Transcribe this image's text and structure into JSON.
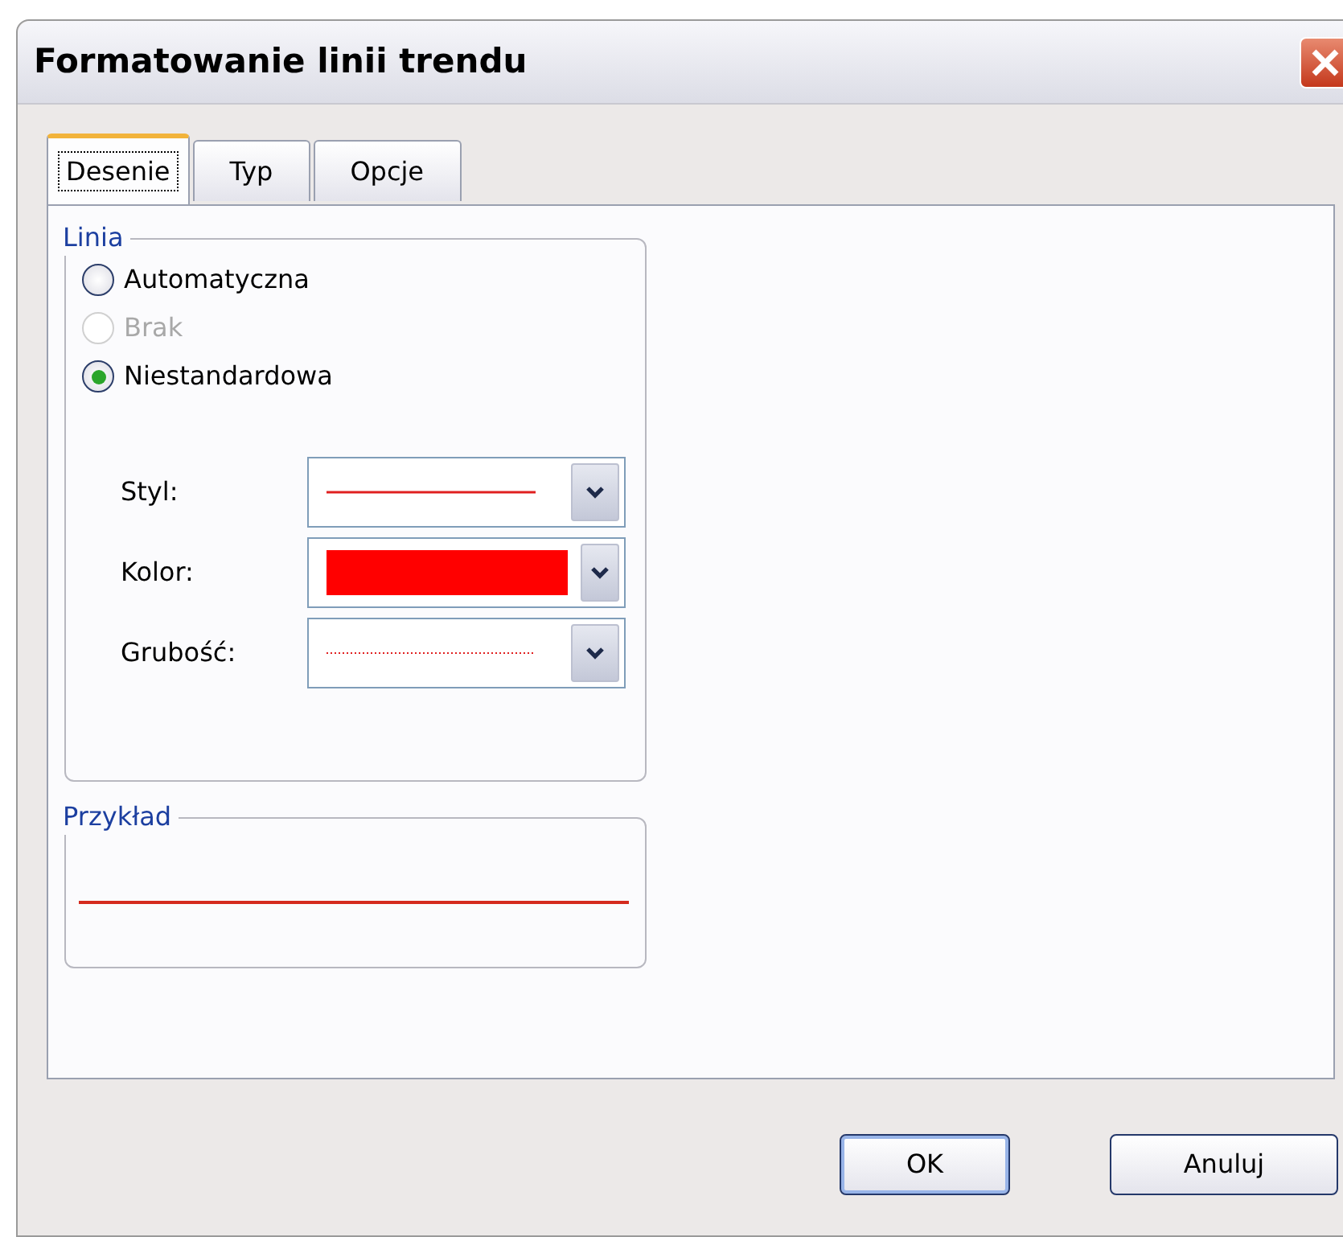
{
  "window": {
    "title": "Formatowanie linii trendu"
  },
  "tabs": [
    {
      "label": "Desenie",
      "selected": true
    },
    {
      "label": "Typ",
      "selected": false
    },
    {
      "label": "Opcje",
      "selected": false
    }
  ],
  "line_group": {
    "title": "Linia",
    "options": [
      {
        "label": "Automatyczna",
        "selected": false,
        "disabled": false
      },
      {
        "label": "Brak",
        "selected": false,
        "disabled": true
      },
      {
        "label": "Niestandardowa",
        "selected": true,
        "disabled": false
      }
    ],
    "fields": [
      {
        "label": "Styl:",
        "kind": "solid",
        "color": "#e02020"
      },
      {
        "label": "Kolor:",
        "kind": "swatch",
        "color": "#ff0000"
      },
      {
        "label": "Grubość:",
        "kind": "dotted",
        "color": "#e02020"
      }
    ]
  },
  "sample_group": {
    "title": "Przykład",
    "color": "#d42a1e"
  },
  "buttons": [
    {
      "label": "OK",
      "kind": "default"
    },
    {
      "label": "Anuluj",
      "kind": "normal"
    }
  ]
}
